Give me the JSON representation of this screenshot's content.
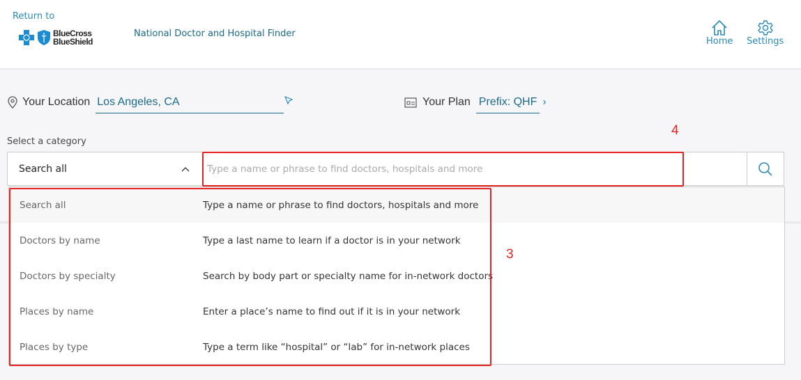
{
  "header": {
    "return_label": "Return to",
    "logo_text": [
      "BlueCross",
      "BlueShield"
    ],
    "app_title": "National Doctor and Hospital Finder",
    "home_label": "Home",
    "settings_label": "Settings"
  },
  "location": {
    "label": "Your Location",
    "value": "Los Angeles, CA"
  },
  "plan": {
    "label": "Your Plan",
    "value": "Prefix: QHF"
  },
  "search": {
    "category_label": "Select a category",
    "selected": "Search all",
    "placeholder": "Type a name or phrase to find doctors, hospitals and more"
  },
  "dropdown": {
    "options": [
      {
        "name": "Search all",
        "desc": "Type a name or phrase to find doctors, hospitals and more"
      },
      {
        "name": "Doctors by name",
        "desc": "Type a last name to learn if a doctor is in your network"
      },
      {
        "name": "Doctors by specialty",
        "desc": "Search by body part or specialty name for in-network doctors"
      },
      {
        "name": "Places by name",
        "desc": "Enter a place’s name to find out if it is in your network"
      },
      {
        "name": "Places by type",
        "desc": "Type a term like “hospital” or “lab” for in-network places"
      }
    ]
  },
  "annotations": {
    "dropdown_label": "3",
    "search_label": "4",
    "color": "#e52421"
  },
  "colors": {
    "accent": "#2a8ab5",
    "link": "#1a6a8a"
  }
}
